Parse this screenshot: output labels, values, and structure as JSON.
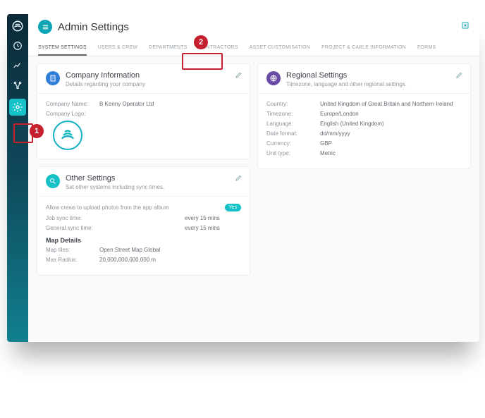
{
  "header": {
    "title": "Admin Settings"
  },
  "tabs": [
    {
      "label": "SYSTEM SETTINGS"
    },
    {
      "label": "USERS & CREW"
    },
    {
      "label": "DEPARTMENTS"
    },
    {
      "label": "CONTRACTORS"
    },
    {
      "label": "ASSET CUSTOMISATION"
    },
    {
      "label": "PROJECT & CABLE INFORMATION"
    },
    {
      "label": "FORMS"
    }
  ],
  "company_card": {
    "title": "Company Information",
    "subtitle": "Details regarding your company",
    "name_label": "Company Name:",
    "name_value": "B Kenny Operator Ltd",
    "logo_label": "Company Logo:"
  },
  "regional_card": {
    "title": "Regional Settings",
    "subtitle": "Timezone, language and other regional settings.",
    "rows": [
      {
        "label": "Country:",
        "value": "United Kingdom of Great Britain and Northern Ireland"
      },
      {
        "label": "Timezone:",
        "value": "Europe/London"
      },
      {
        "label": "Language:",
        "value": "English (United Kingdom)"
      },
      {
        "label": "Date format:",
        "value": "dd/mm/yyyy"
      },
      {
        "label": "Currency:",
        "value": "GBP"
      },
      {
        "label": "Unit type:",
        "value": "Metric"
      }
    ]
  },
  "other_card": {
    "title": "Other Settings",
    "subtitle": "Set other systems including sync times.",
    "allow_label": "Allow crews to upload photos from the app album",
    "allow_badge": "Yes",
    "job_sync_label": "Job sync time:",
    "job_sync_value": "every 15 mins",
    "gen_sync_label": "General sync time:",
    "gen_sync_value": "every 15 mins",
    "map_heading": "Map Details",
    "map_tiles_label": "Map tiles:",
    "map_tiles_value": "Open Street Map Global",
    "max_radius_label": "Max Radius:",
    "max_radius_value": "20,000,000,000,000 m"
  },
  "annotations": {
    "m1": "1",
    "m2": "2"
  }
}
